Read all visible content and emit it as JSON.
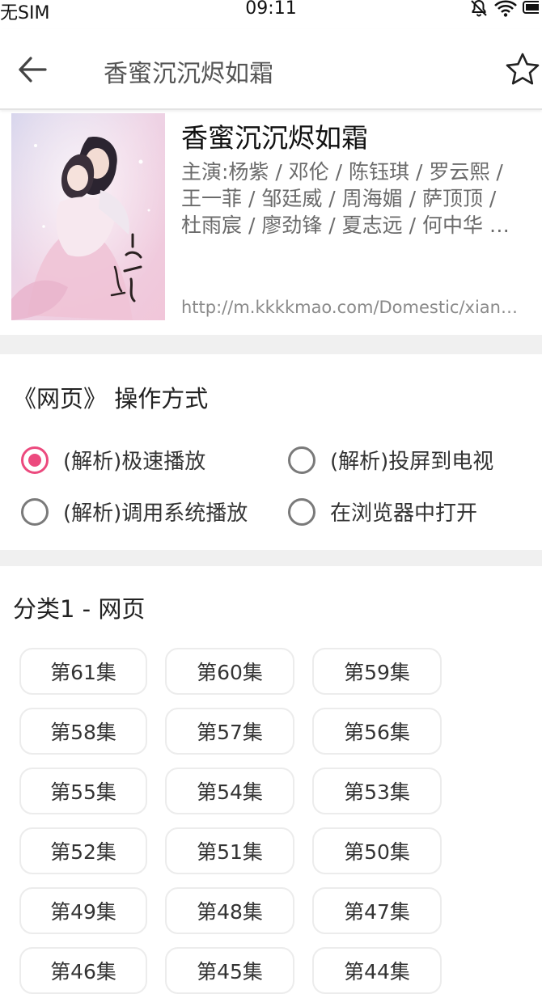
{
  "status_bar": {
    "carrier": "无SIM",
    "time": "09:11"
  },
  "nav": {
    "title": "香蜜沉沉烬如霜"
  },
  "show": {
    "title": "香蜜沉沉烬如霜",
    "cast_lines": [
      "主演:杨紫 / 邓伦 / 陈钰琪 / 罗云熙 /",
      "王一菲 / 邹廷威 / 周海媚 / 萨顶顶 /",
      "杜雨宸 / 廖劲锋 / 夏志远 / 何中华 …"
    ],
    "source_url": "http://m.kkkkmao.com/Domestic/xian…"
  },
  "operation": {
    "title": "《网页》 操作方式",
    "options": [
      {
        "label": "(解析)极速播放",
        "selected": true
      },
      {
        "label": "(解析)投屏到电视",
        "selected": false
      },
      {
        "label": "(解析)调用系统播放",
        "selected": false
      },
      {
        "label": "在浏览器中打开",
        "selected": false
      }
    ]
  },
  "category": {
    "title": "分类1 - 网页",
    "episodes": [
      "第61集",
      "第60集",
      "第59集",
      "第58集",
      "第57集",
      "第56集",
      "第55集",
      "第54集",
      "第53集",
      "第52集",
      "第51集",
      "第50集",
      "第49集",
      "第48集",
      "第47集",
      "第46集",
      "第45集",
      "第44集"
    ]
  },
  "colors": {
    "accent": "#ec4a7e",
    "divider": "#f0f0f0"
  }
}
